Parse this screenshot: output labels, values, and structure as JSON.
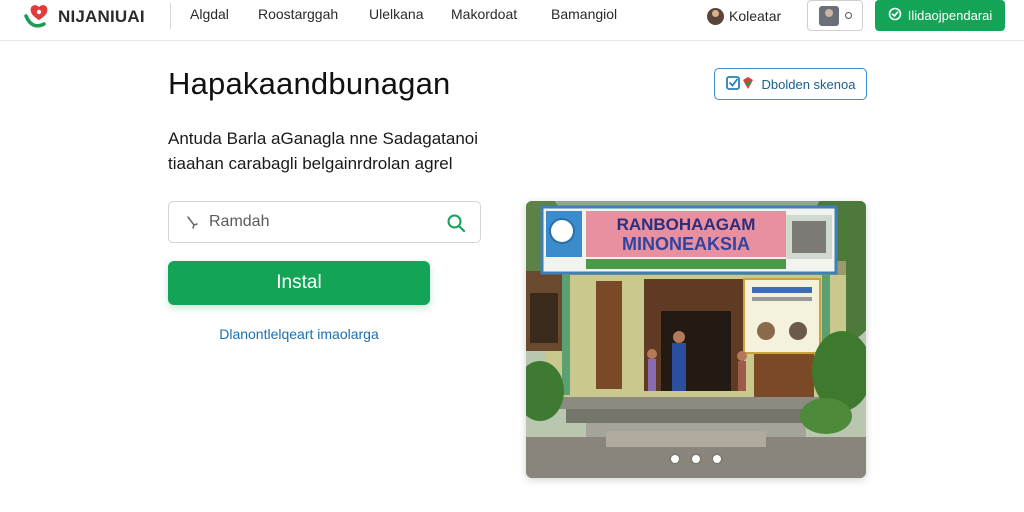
{
  "header": {
    "logo_text": "NIJANIUAI",
    "nav": [
      "Algdal",
      "Roostarggah",
      "Ulelkana",
      "Makordoat",
      "Bamangiol"
    ],
    "user_name": "Koleatar",
    "cta_label": "Ilidaojpendarai"
  },
  "hero": {
    "title": "Hapakaandbunagan",
    "subtitle_line1": "Antuda Barla aGanagla nne Sadagatanoi",
    "subtitle_line2": "tiaahan carabagli belgainrdrolan agrel",
    "badge_label": "Dbolden skenoa",
    "search_placeholder": "Ramdah",
    "install_label": "Instal",
    "link_label": "Dlanontlelqeart imaolarga"
  },
  "photo": {
    "banner_line1": "RANBOHAAGAM",
    "banner_line2": "MINONEAKSIA",
    "slide_count": 3,
    "active_slide": 1
  },
  "colors": {
    "brand_green": "#14a458",
    "link_blue": "#1a6fb3",
    "badge_border": "#3a8ec9",
    "logo_red": "#e23b3b",
    "logo_green": "#1f9a55"
  }
}
